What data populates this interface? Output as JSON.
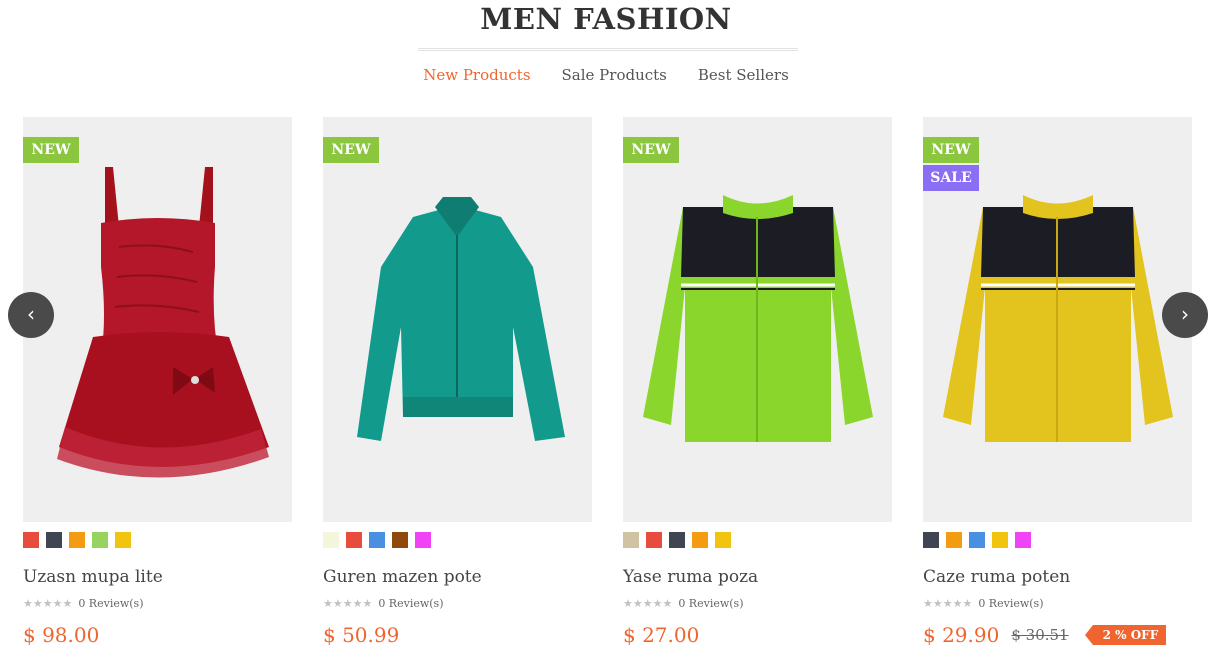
{
  "section": {
    "title": "MEN FASHION",
    "tabs": [
      {
        "label": "New Products",
        "active": true
      },
      {
        "label": "Sale Products",
        "active": false
      },
      {
        "label": "Best Sellers",
        "active": false
      }
    ]
  },
  "navigation": {
    "prev_icon": "‹",
    "next_icon": "›"
  },
  "products": [
    {
      "name": "Uzasn mupa lite",
      "badges": [
        "NEW"
      ],
      "swatches": [
        "#e84c3d",
        "#3f4651",
        "#f39c12",
        "#96d35f",
        "#f1c40f"
      ],
      "stars": "★★★★★",
      "reviews": "0 Review(s)",
      "price": "$ 98.00",
      "image": "red-dress"
    },
    {
      "name": "Guren mazen pote",
      "badges": [
        "NEW"
      ],
      "swatches": [
        "#f5f5dc",
        "#e84c3d",
        "#4a90e2",
        "#8e4a0c",
        "#f043f5"
      ],
      "stars": "★★★★★",
      "reviews": "0 Review(s)",
      "price": "$ 50.99",
      "image": "teal-jacket"
    },
    {
      "name": "Yase ruma poza",
      "badges": [
        "NEW"
      ],
      "swatches": [
        "#cfc3a3",
        "#e84c3d",
        "#3f4651",
        "#f39c12",
        "#f1c40f"
      ],
      "stars": "★★★★★",
      "reviews": "0 Review(s)",
      "price": "$ 27.00",
      "image": "green-cardigan"
    },
    {
      "name": "Caze ruma poten",
      "badges": [
        "NEW",
        "SALE"
      ],
      "swatches": [
        "#3f4651",
        "#f39c12",
        "#4a90e2",
        "#f1c40f",
        "#f043f5"
      ],
      "stars": "★★★★★",
      "reviews": "0 Review(s)",
      "price": "$ 29.90",
      "old_price": "$ 30.51",
      "discount": "2 % OFF",
      "image": "yellow-cardigan"
    }
  ],
  "colors": {
    "accent": "#f0652f",
    "new_badge": "#8cc63f",
    "sale_badge": "#8a6ff5"
  }
}
